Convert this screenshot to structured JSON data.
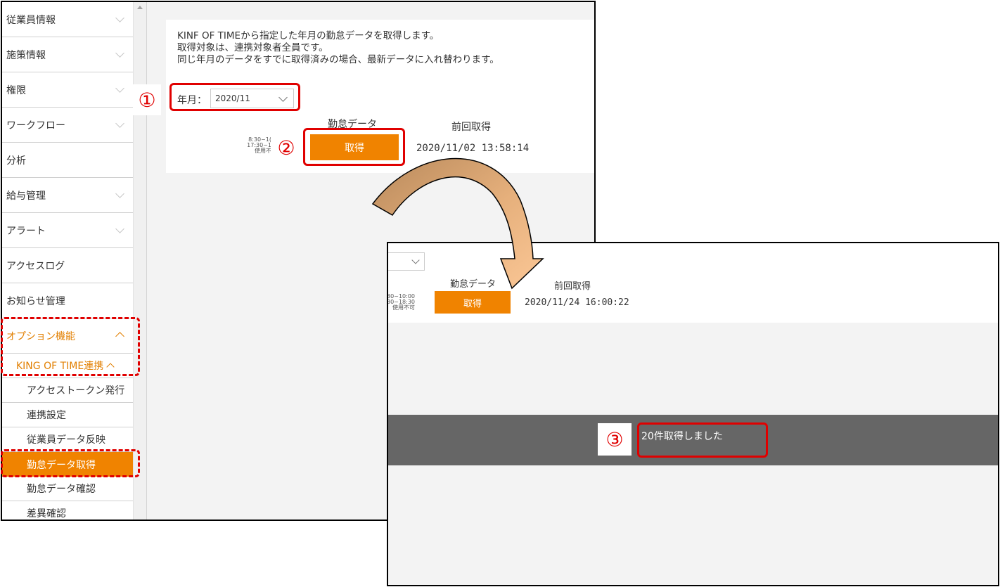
{
  "sidebar": {
    "items": [
      {
        "label": "従業員情報"
      },
      {
        "label": "施策情報"
      },
      {
        "label": "権限"
      },
      {
        "label": "ワークフロー"
      },
      {
        "label": "分析"
      },
      {
        "label": "給与管理"
      },
      {
        "label": "アラート"
      },
      {
        "label": "アクセスログ"
      },
      {
        "label": "お知らせ管理"
      },
      {
        "label": "オプション機能"
      }
    ],
    "kot": {
      "label": "KING OF TIME連携"
    },
    "sub_items": [
      {
        "label": "アクセストークン発行"
      },
      {
        "label": "連携設定"
      },
      {
        "label": "従業員データ反映"
      },
      {
        "label": "勤怠データ取得"
      },
      {
        "label": "勤怠データ確認"
      },
      {
        "label": "差異確認"
      }
    ]
  },
  "panel": {
    "description": [
      "KINF OF TIMEから指定した年月の勤怠データを取得します。",
      "取得対象は、連携対象者全員です。",
      "同じ年月のデータをすでに取得済みの場合、最新データに入れ替わります。"
    ],
    "year_month_label": "年月：",
    "year_month_value": "2020/11",
    "col_attendance": "勤怠データ",
    "col_last": "前回取得",
    "time_note": [
      "8:30~1(",
      "17:30~1",
      "使用不"
    ],
    "fetch_button": "取得",
    "last_fetched": "2020/11/02 13:58:14"
  },
  "result": {
    "col_attendance": "勤怠データ",
    "col_last": "前回取得",
    "time_note": [
      "30~10:00",
      "30~18:30",
      "使用不可"
    ],
    "fetch_button": "取得",
    "last_fetched": "2020/11/24 16:00:22",
    "toast": "20件取得しました"
  },
  "annotations": {
    "step1": "①",
    "step2": "②",
    "step3": "③"
  },
  "colors": {
    "accent": "#f08300",
    "highlight": "#e00000",
    "toast_bg": "#666666"
  }
}
